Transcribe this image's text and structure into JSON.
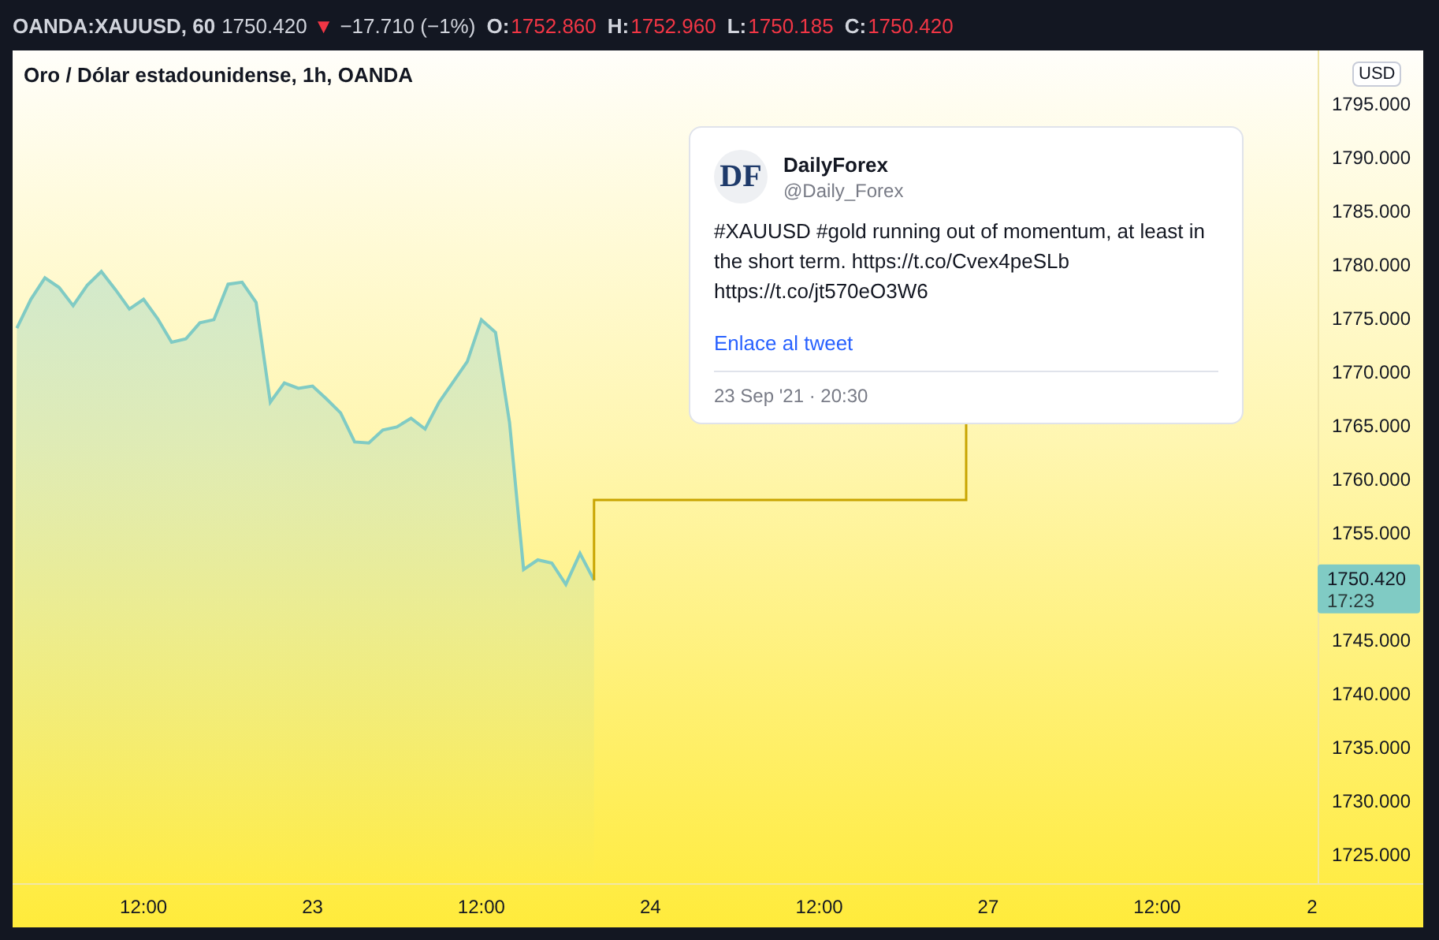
{
  "header": {
    "symbol": "OANDA:XAUUSD, 60",
    "price": "1750.420",
    "direction_icon": "▼",
    "change": "−17.710 (−1%)",
    "ohlc": [
      {
        "label": "O:",
        "value": "1752.860"
      },
      {
        "label": "H:",
        "value": "1752.960"
      },
      {
        "label": "L:",
        "value": "1750.185"
      },
      {
        "label": "C:",
        "value": "1750.420"
      }
    ]
  },
  "chart_title": "Oro / Dólar estadounidense, 1h, OANDA",
  "currency_badge": "USD",
  "chart_data": {
    "type": "area",
    "ylim": [
      1722.35,
      1800
    ],
    "categories": [
      null,
      null,
      null,
      null,
      null,
      null,
      null,
      null,
      null,
      "12:00",
      null,
      null,
      null,
      null,
      null,
      null,
      null,
      null,
      null,
      null,
      null,
      "23",
      null,
      null,
      null,
      null,
      null,
      null,
      null,
      null,
      null,
      null,
      null,
      "12:00",
      null,
      null,
      null,
      null,
      null,
      null,
      null,
      null,
      null,
      null,
      null,
      "24",
      null,
      null,
      null,
      null,
      null,
      null,
      null,
      null,
      null,
      null,
      null,
      "12:00",
      null,
      null,
      null,
      null,
      null,
      null,
      null,
      null,
      null,
      null,
      null,
      "27",
      null,
      null,
      null,
      null,
      null,
      null,
      null,
      null,
      null,
      null,
      null,
      "12:00",
      null,
      null,
      null,
      null,
      null,
      null,
      null,
      null,
      null,
      null,
      "2"
    ],
    "series": [
      {
        "color": "#80cbc4",
        "values": [
          1774.1,
          1776.8,
          1778.8,
          1777.9,
          1776.2,
          1778.1,
          1779.4,
          1777.7,
          1775.9,
          1776.8,
          1775.0,
          1772.8,
          1773.1,
          1774.6,
          1774.9,
          1778.2,
          1778.4,
          1776.5,
          1767.2,
          1769.0,
          1768.5,
          1768.7,
          1767.5,
          1766.2,
          1763.5,
          1763.4,
          1764.6,
          1764.9,
          1765.7,
          1764.7,
          1767.2,
          1769.1,
          1771.0,
          1774.9,
          1773.7,
          1765.3,
          1751.6,
          1752.5,
          1752.2,
          1750.2,
          1753.1,
          1750.6,
          null,
          null,
          null,
          null,
          null,
          null,
          null,
          null,
          null,
          null,
          null,
          null,
          null,
          null,
          null,
          null,
          null,
          null,
          null,
          null,
          null,
          null,
          null,
          null,
          null,
          null,
          null,
          null,
          null,
          null,
          null,
          null,
          null,
          null,
          null,
          null,
          null,
          null,
          null,
          null,
          null,
          null,
          null,
          null,
          null,
          null,
          null,
          null,
          null,
          null,
          null
        ]
      }
    ],
    "yticks": [
      {
        "value": 1795,
        "label": "1795.000"
      },
      {
        "value": 1790,
        "label": "1790.000"
      },
      {
        "value": 1785,
        "label": "1785.000"
      },
      {
        "value": 1780,
        "label": "1780.000"
      },
      {
        "value": 1775,
        "label": "1775.000"
      },
      {
        "value": 1770,
        "label": "1770.000"
      },
      {
        "value": 1765,
        "label": "1765.000"
      },
      {
        "value": 1760,
        "label": "1760.000"
      },
      {
        "value": 1755,
        "label": "1755.000"
      },
      {
        "value": 1745,
        "label": "1745.000"
      },
      {
        "value": 1740,
        "label": "1740.000"
      },
      {
        "value": 1735,
        "label": "1735.000"
      },
      {
        "value": 1730,
        "label": "1730.000"
      },
      {
        "value": 1725,
        "label": "1725.000"
      }
    ]
  },
  "price_label": {
    "price": "1750.420",
    "countdown": "17:23"
  },
  "tweet": {
    "author": "DailyForex",
    "avatar_text": "DF",
    "handle": "@Daily_Forex",
    "text": "#XAUUSD #gold running out of momentum, at least in the short term. https://t.co/Cvex4peSLb https://t.co/jt570eO3W6",
    "link": "Enlace al tweet",
    "date": "23 Sep '21 · 20:30"
  }
}
